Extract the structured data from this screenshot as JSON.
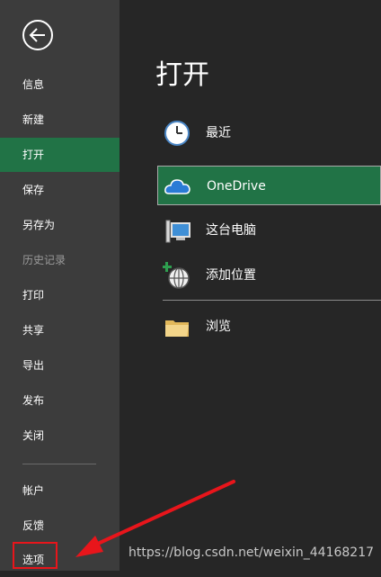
{
  "sidebar": {
    "back_icon": "back-arrow-icon",
    "items": [
      {
        "label": "信息"
      },
      {
        "label": "新建"
      },
      {
        "label": "打开"
      },
      {
        "label": "保存"
      },
      {
        "label": "另存为"
      },
      {
        "label": "历史记录"
      },
      {
        "label": "打印"
      },
      {
        "label": "共享"
      },
      {
        "label": "导出"
      },
      {
        "label": "发布"
      },
      {
        "label": "关闭"
      },
      {
        "label": "帐户"
      },
      {
        "label": "反馈"
      },
      {
        "label": "选项"
      }
    ],
    "active_item": "打开",
    "disabled_item": "历史记录"
  },
  "main": {
    "title": "打开",
    "locations": [
      {
        "label": "最近",
        "icon": "clock-icon"
      },
      {
        "label": "OneDrive",
        "icon": "cloud-icon"
      },
      {
        "label": "这台电脑",
        "icon": "computer-icon"
      },
      {
        "label": "添加位置",
        "icon": "add-globe-icon"
      },
      {
        "label": "浏览",
        "icon": "folder-icon"
      }
    ]
  },
  "annotation": {
    "color": "#e8151b"
  },
  "watermark": "https://blog.csdn.net/weixin_44168217",
  "colors": {
    "accent": "#217346",
    "sidebar": "#3c3c3c",
    "background": "#262626"
  }
}
